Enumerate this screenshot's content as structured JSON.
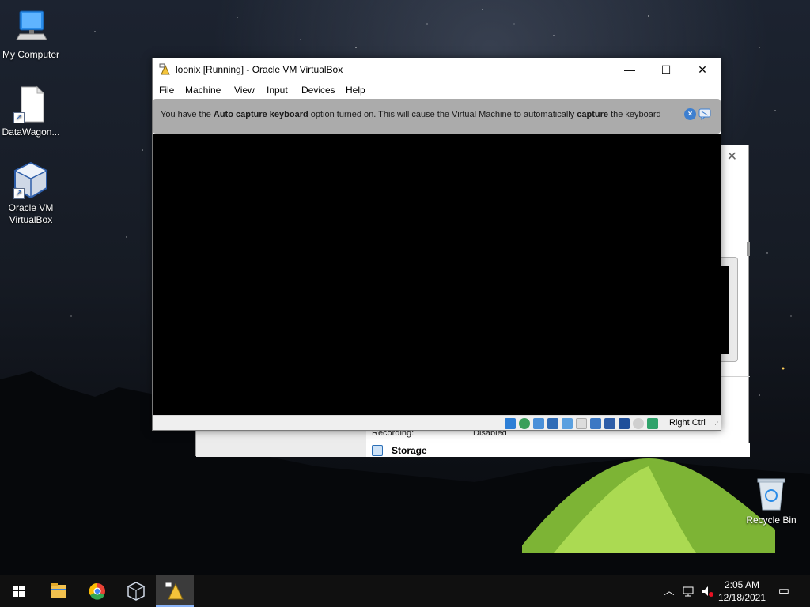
{
  "desktop": {
    "icons": [
      {
        "label": "My Computer",
        "icon": "computer-icon"
      },
      {
        "label": "DataWagon...",
        "icon": "document-icon"
      },
      {
        "label": "Oracle VM VirtualBox",
        "icon": "virtualbox-icon"
      }
    ],
    "recycle_bin": {
      "label": "Recycle Bin",
      "icon": "recycle-bin-icon"
    }
  },
  "vm_window": {
    "title": "loonix [Running] - Oracle VM VirtualBox",
    "controls": {
      "minimize": "—",
      "maximize": "☐",
      "close": "✕"
    },
    "menu": [
      "File",
      "Machine",
      "View",
      "Input",
      "Devices",
      "Help"
    ],
    "notice": {
      "part1": "You have the ",
      "bold1": "Auto capture keyboard",
      "part2": " option turned on. This will cause the Virtual Machine to automatically ",
      "bold2": "capture",
      "part3": " the keyboard",
      "close_icon": "close-circle-icon",
      "dismiss_icon": "dismiss-bubble-icon"
    },
    "status_icons": [
      "hard-disk-icon",
      "optical-drive-icon",
      "audio-icon",
      "network-icon",
      "usb-icon",
      "shared-folders-icon",
      "display-icon",
      "video-capture-icon",
      "cpu-icon",
      "mouse-integration-icon",
      "host-key-icon"
    ],
    "host_key": "Right Ctrl"
  },
  "background_window": {
    "close": "✕",
    "recording_label": "Recording:",
    "recording_value": "Disabled",
    "storage_label": "Storage"
  },
  "taskbar": {
    "apps": [
      "start-icon",
      "file-explorer-icon",
      "chrome-icon",
      "virtualbox-icon",
      "virtualbox-vm-icon"
    ],
    "tray_icons": [
      "chevron-up-icon",
      "network-icon",
      "volume-muted-icon"
    ],
    "time": "2:05 AM",
    "date": "12/18/2021",
    "notification_icon": "notification-icon"
  },
  "colors": {
    "accent": "#3d7fd0",
    "notice_bg": "#ababab",
    "vm_screen": "#000000",
    "taskbar": "#101010"
  }
}
